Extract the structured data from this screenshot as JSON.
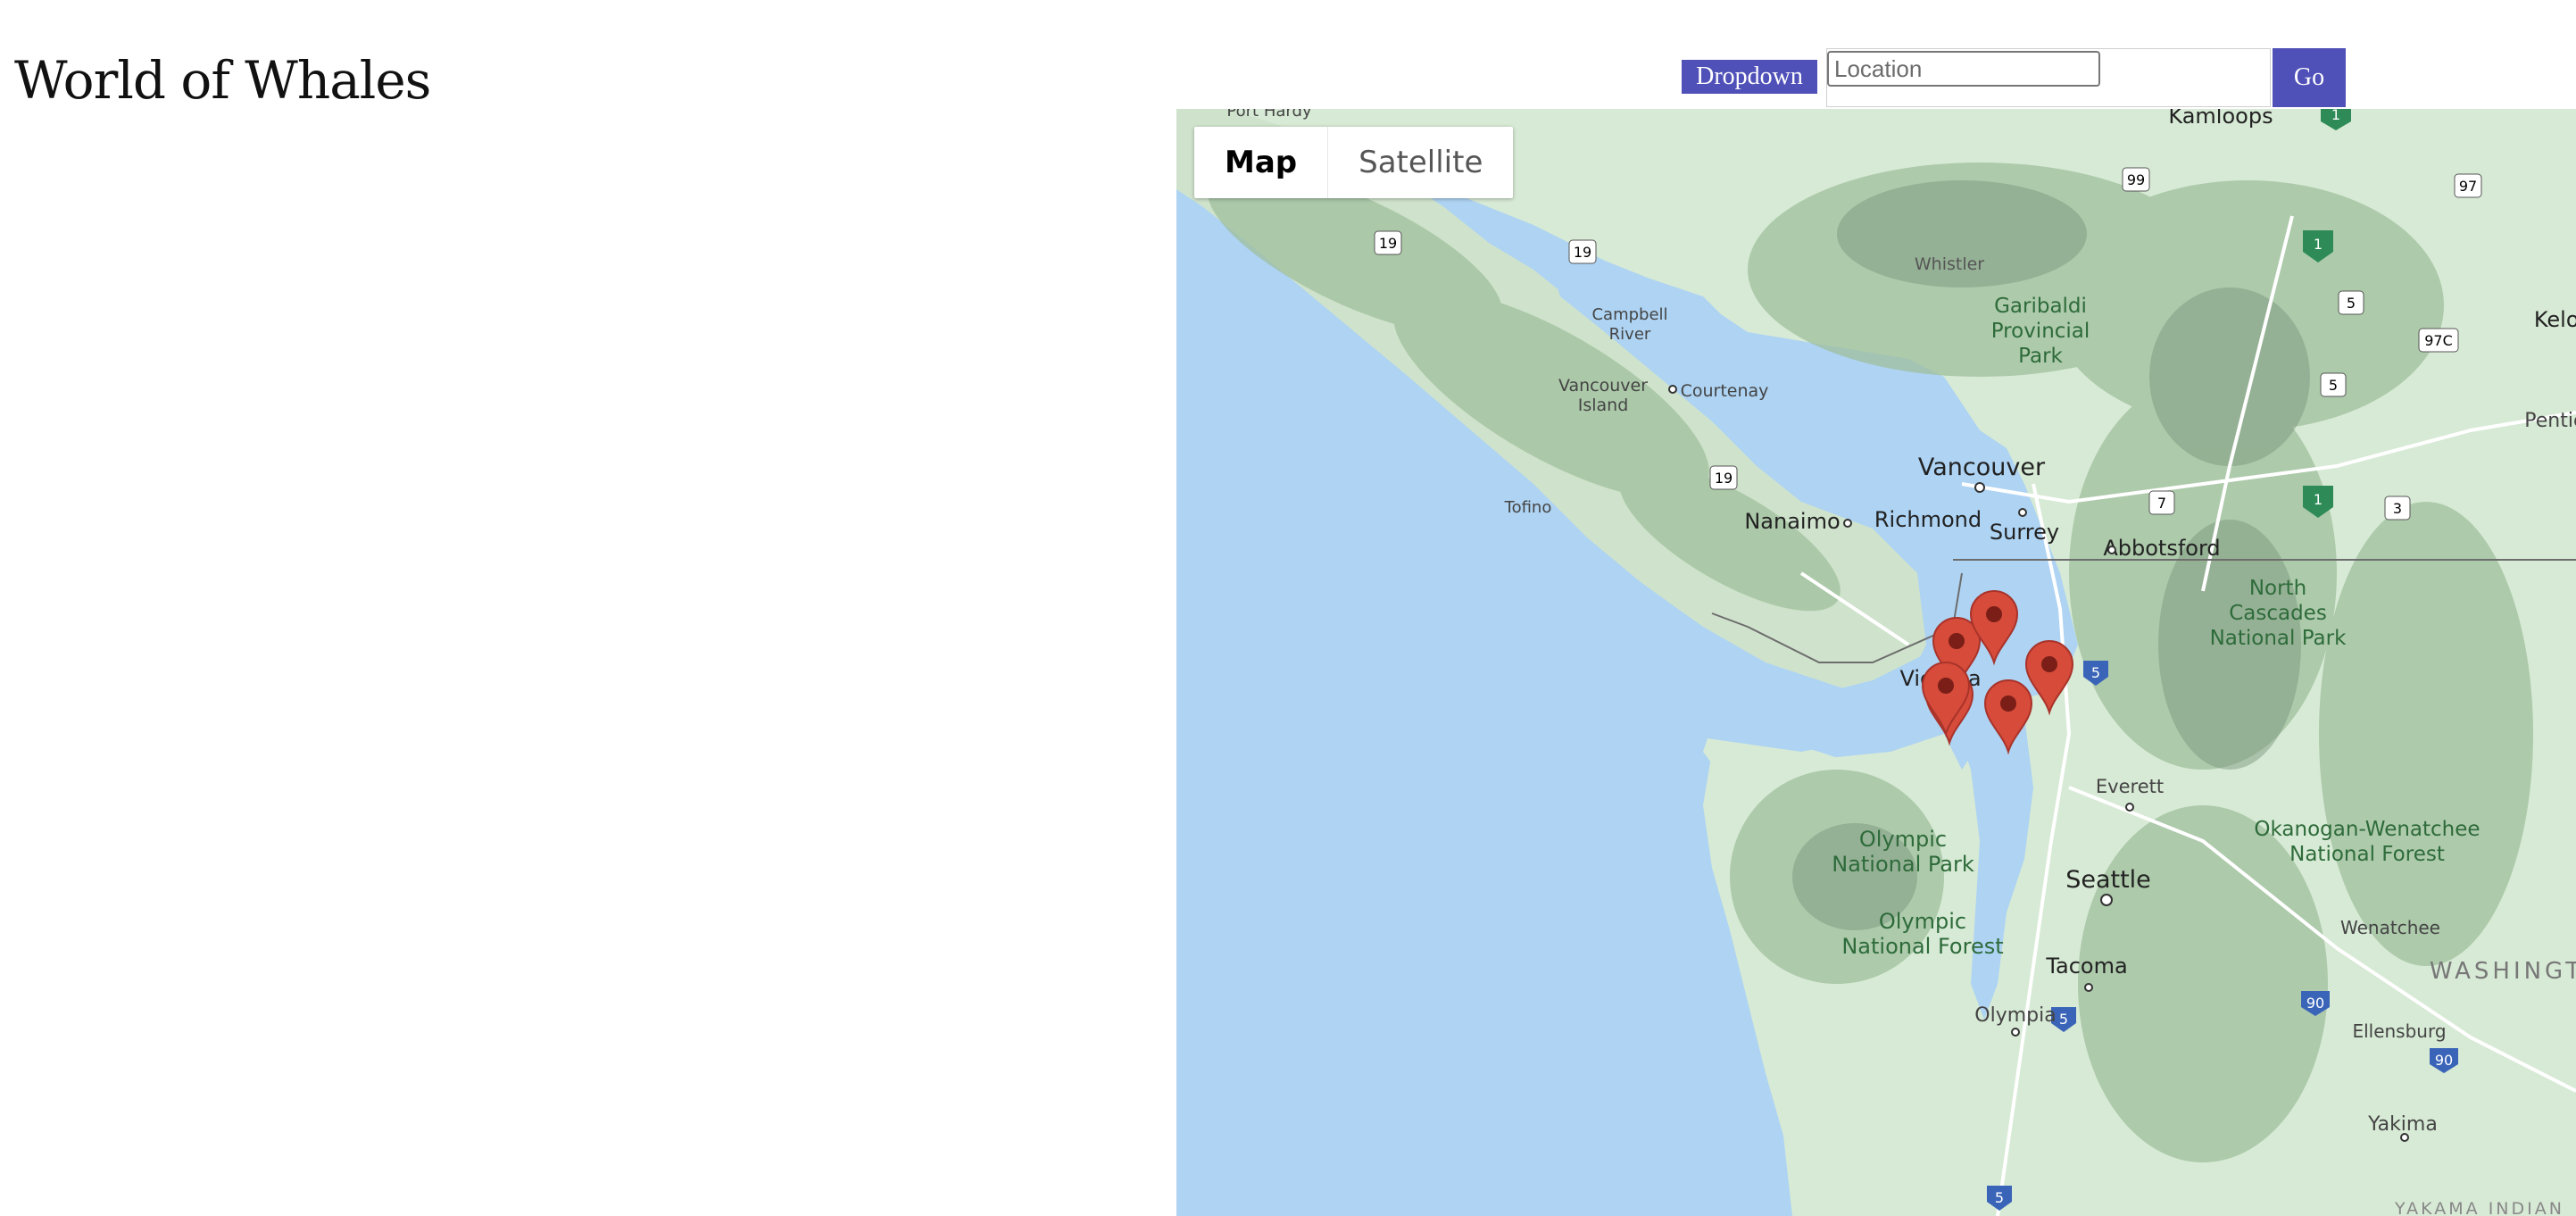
{
  "page": {
    "title": "World of Whales"
  },
  "toolbar": {
    "dropdown_label": "Dropdown",
    "location_placeholder": "Location",
    "location_value": "",
    "go_label": "Go"
  },
  "map": {
    "map_type_options": [
      "Map",
      "Satellite"
    ],
    "selected_map_type": "Map",
    "marker_count": 6,
    "labels": {
      "port_hardy": "Port Hardy",
      "kamloops": "Kamloops",
      "whistler": "Whistler",
      "garibaldi_1": "Garibaldi",
      "garibaldi_2": "Provincial",
      "garibaldi_3": "Park",
      "campbell_1": "Campbell",
      "campbell_2": "River",
      "vancouver_island_1": "Vancouver",
      "vancouver_island_2": "Island",
      "courtenay": "Courtenay",
      "vancouver": "Vancouver",
      "tofino": "Tofino",
      "nanaimo": "Nanaimo",
      "richmond": "Richmond",
      "surrey": "Surrey",
      "abbotsford": "Abbotsford",
      "kelowna": "Kelow",
      "penticton": "Pentict",
      "north_cascades_1": "North",
      "north_cascades_2": "Cascades",
      "north_cascades_3": "National Park",
      "victoria": "Victoria",
      "everett": "Everett",
      "olympic_np_1": "Olympic",
      "olympic_np_2": "National Park",
      "seattle": "Seattle",
      "okanogan_1": "Okanogan-Wenatchee",
      "okanogan_2": "National Forest",
      "olympic_nf_1": "Olympic",
      "olympic_nf_2": "National Forest",
      "tacoma": "Tacoma",
      "wenatchee": "Wenatchee",
      "washington": "WASHINGT",
      "olympia": "Olympia",
      "ellensburg": "Ellensburg",
      "yakima": "Yakima",
      "yakama": "YAKAMA INDIAN"
    },
    "route_shields": {
      "r19a": "19",
      "r19b": "19",
      "r19c": "19",
      "r99": "99",
      "r97": "97",
      "r1a": "1",
      "r1b": "1",
      "r1c": "1",
      "r5a": "5",
      "r5b": "5",
      "r97c": "97C",
      "r7": "7",
      "r3": "3",
      "i5a": "5",
      "i5b": "5",
      "i5c": "5",
      "i90a": "90",
      "i90b": "90"
    },
    "colors": {
      "water": "#aed3f3",
      "land": "#d7ead5",
      "forest": "#a9c8a4",
      "mountain": "#8aa48b",
      "road": "#ffffff",
      "marker": "#d64b3a",
      "accent_button": "#5051b8"
    }
  }
}
